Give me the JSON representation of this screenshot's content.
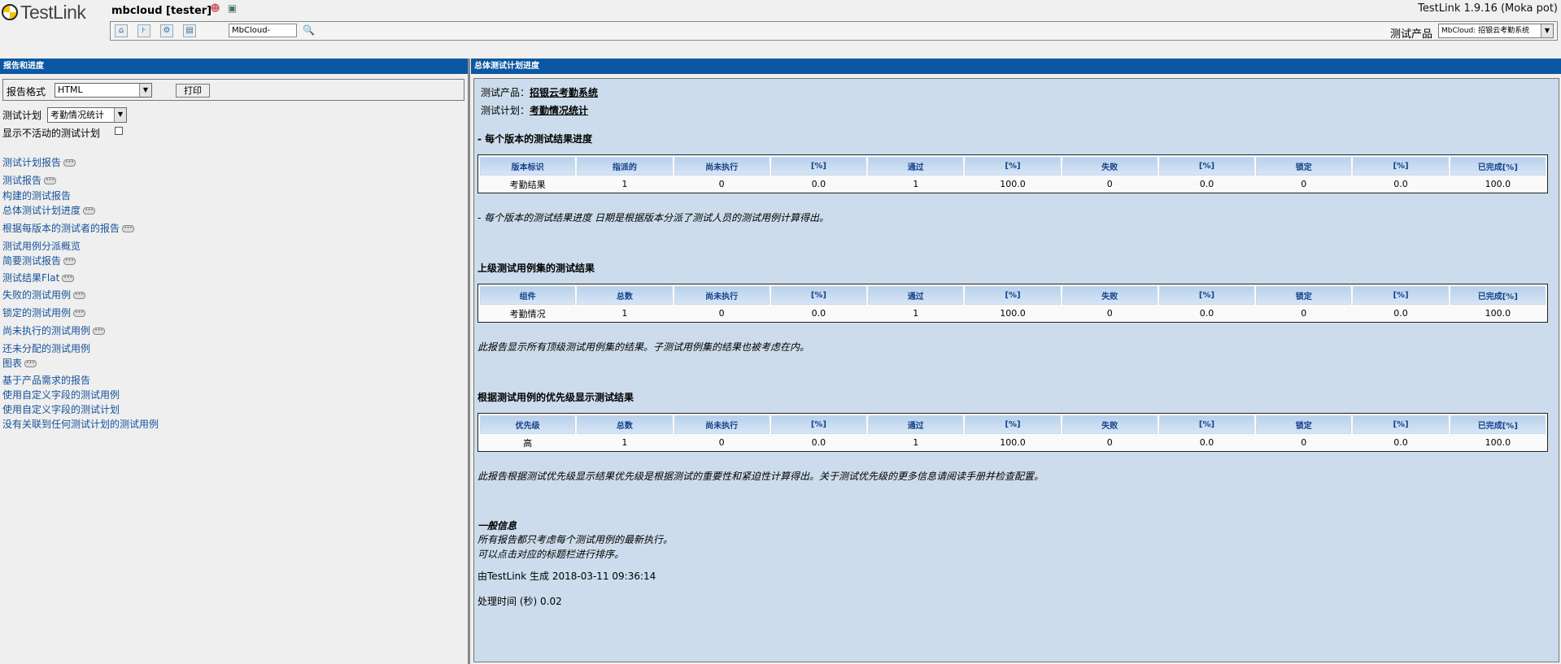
{
  "header": {
    "logo": "TestLink",
    "user": "mbcloud [tester]",
    "version": "TestLink 1.9.16 (Moka pot)",
    "search_value": "MbCloud-",
    "product_label": "测试产品",
    "product_value": "MbCloud: 招银云考勤系统"
  },
  "left": {
    "title": "报告和进度",
    "format_label": "报告格式",
    "format_value": "HTML",
    "print_label": "打印",
    "plan_label": "测试计划",
    "plan_value": "考勤情况统计",
    "inactive_label": "显示不活动的测试计划",
    "links": [
      {
        "label": "测试计划报告",
        "dots": true
      },
      {
        "label": "测试报告",
        "dots": true
      },
      {
        "label": "构建的测试报告",
        "dots": false
      },
      {
        "label": "总体测试计划进度",
        "dots": true
      },
      {
        "label": "根据每版本的测试者的报告",
        "dots": true
      },
      {
        "label": "测试用例分派概览",
        "dots": false
      },
      {
        "label": "简要测试报告",
        "dots": true
      },
      {
        "label": "测试结果Flat",
        "dots": true
      },
      {
        "label": "失败的测试用例",
        "dots": true
      },
      {
        "label": "锁定的测试用例",
        "dots": true
      },
      {
        "label": "尚未执行的测试用例",
        "dots": true
      },
      {
        "label": "还未分配的测试用例",
        "dots": false
      },
      {
        "label": "图表",
        "dots": true
      },
      {
        "label": "基于产品需求的报告",
        "dots": false
      },
      {
        "label": "使用自定义字段的测试用例",
        "dots": false
      },
      {
        "label": "使用自定义字段的测试计划",
        "dots": false
      },
      {
        "label": "没有关联到任何测试计划的测试用例",
        "dots": false
      }
    ]
  },
  "right": {
    "title": "总体测试计划进度",
    "product_label": "测试产品：",
    "product_value": "招银云考勤系统",
    "plan_label": "测试计划：",
    "plan_value": "考勤情况统计",
    "sec1_title": "- 每个版本的测试结果进度",
    "table1": {
      "headers": [
        "版本标识",
        "指派的",
        "尚未执行",
        "[%]",
        "通过",
        "[%]",
        "失败",
        "[%]",
        "锁定",
        "[%]",
        "已完成[%]"
      ],
      "rows": [
        [
          "考勤结果",
          "1",
          "0",
          "0.0",
          "1",
          "100.0",
          "0",
          "0.0",
          "0",
          "0.0",
          "100.0"
        ]
      ]
    },
    "note1": "- 每个版本的测试结果进度 日期是根据版本分派了测试人员的测试用例计算得出。",
    "sec2_title": "上级测试用例集的测试结果",
    "table2": {
      "headers": [
        "组件",
        "总数",
        "尚未执行",
        "[%]",
        "通过",
        "[%]",
        "失败",
        "[%]",
        "锁定",
        "[%]",
        "已完成[%]"
      ],
      "rows": [
        [
          "考勤情况",
          "1",
          "0",
          "0.0",
          "1",
          "100.0",
          "0",
          "0.0",
          "0",
          "0.0",
          "100.0"
        ]
      ]
    },
    "note2": "此报告显示所有顶级测试用例集的结果。子测试用例集的结果也被考虑在内。",
    "sec3_title": "根据测试用例的优先级显示测试结果",
    "table3": {
      "headers": [
        "优先级",
        "总数",
        "尚未执行",
        "[%]",
        "通过",
        "[%]",
        "失败",
        "[%]",
        "锁定",
        "[%]",
        "已完成[%]"
      ],
      "rows": [
        [
          "高",
          "1",
          "0",
          "0.0",
          "1",
          "100.0",
          "0",
          "0.0",
          "0",
          "0.0",
          "100.0"
        ]
      ]
    },
    "note3": "此报告根据测试优先级显示结果优先级是根据测试的重要性和紧迫性计算得出。关于测试优先级的更多信息请阅读手册并检查配置。",
    "general_title": "一般信息",
    "general_line1": "所有报告都只考虑每个测试用例的最新执行。",
    "general_line2": "可以点击对应的标题栏进行排序。",
    "generated": "由TestLink 生成 2018-03-11 09:36:14",
    "elapsed": "处理时间 (秒) 0.02"
  }
}
